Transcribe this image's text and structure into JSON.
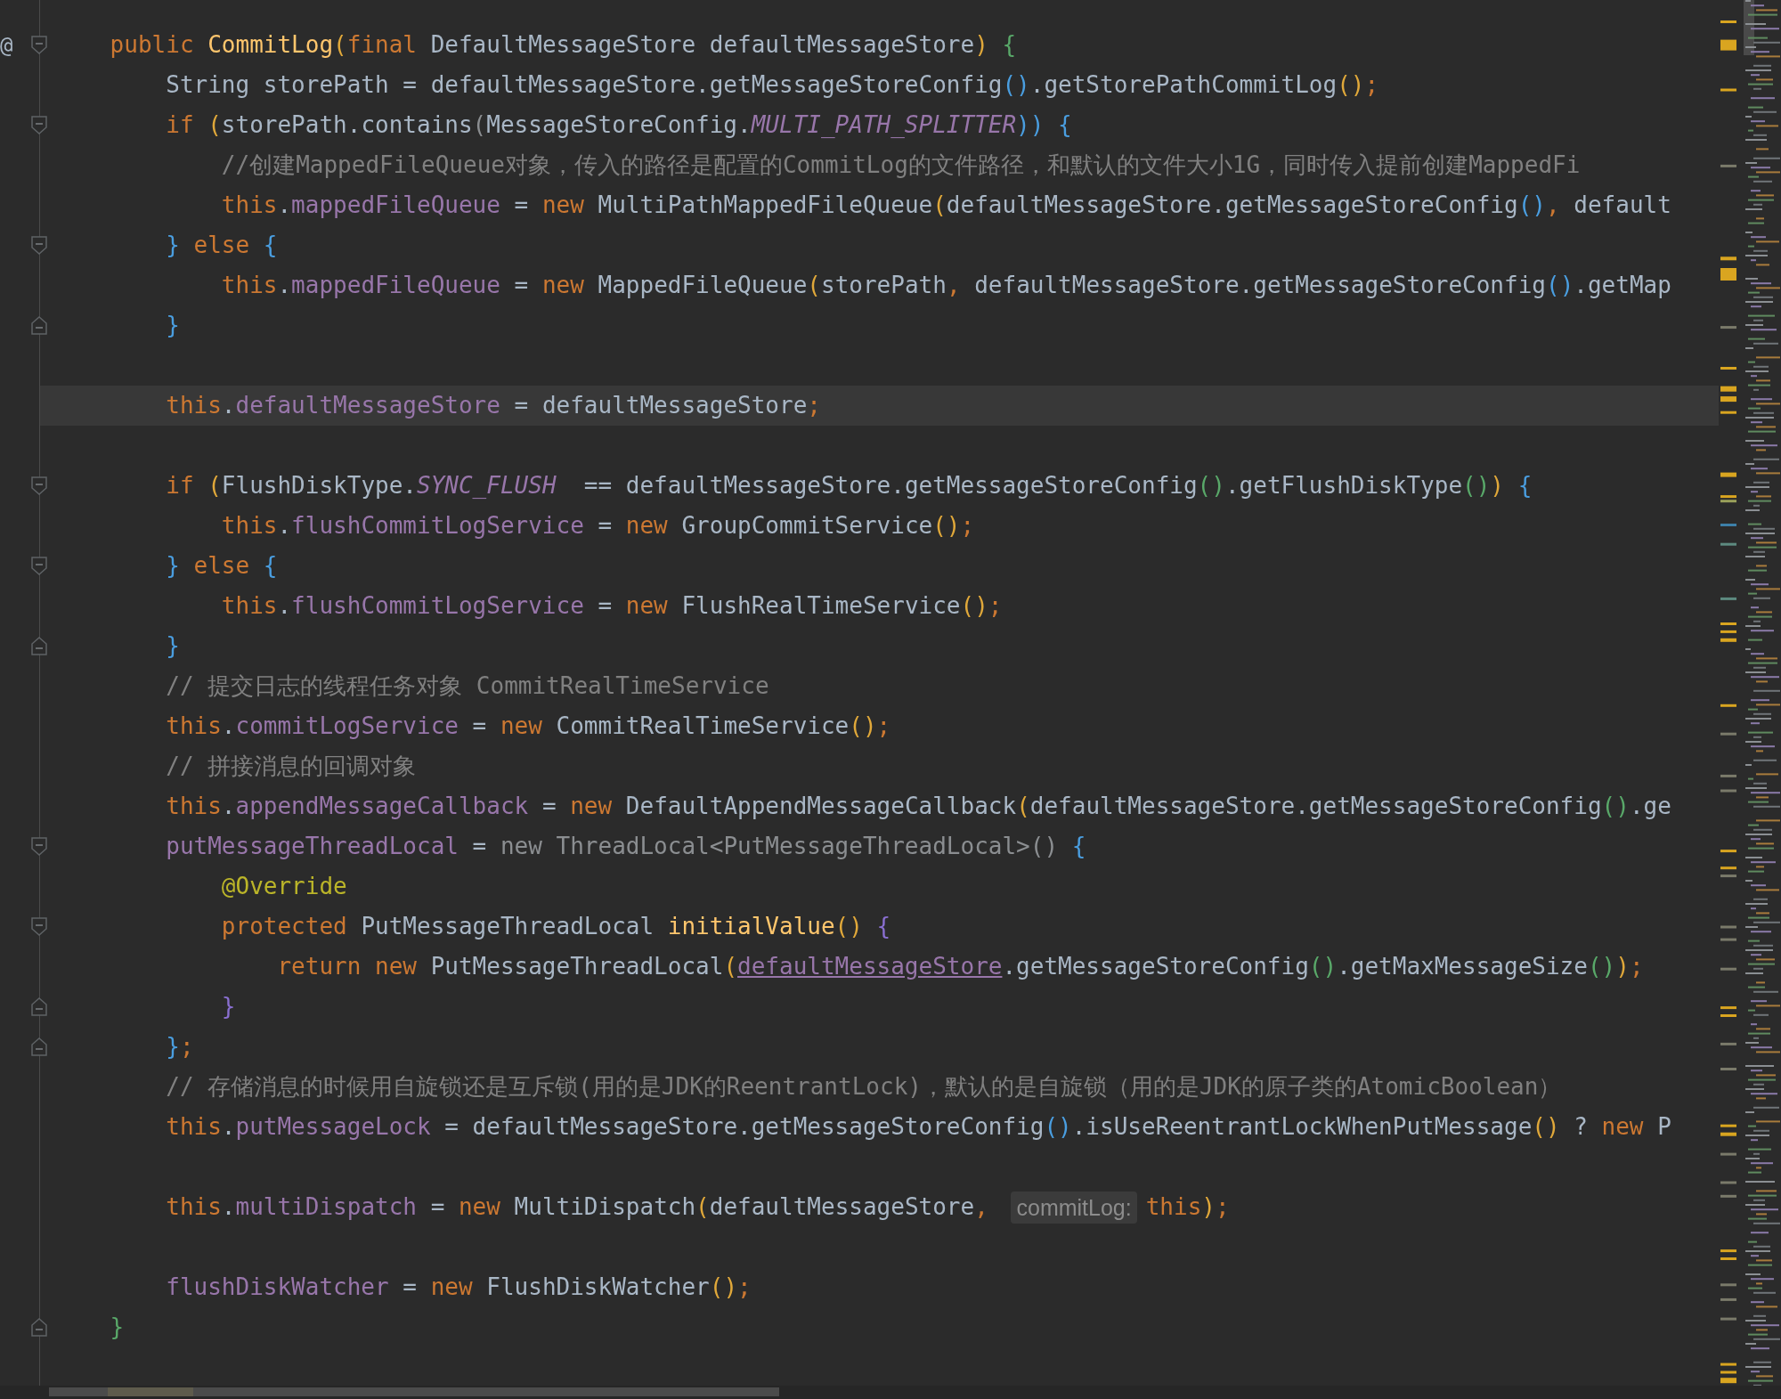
{
  "editor": {
    "lines": [
      {
        "gutter": "@",
        "kind": "open",
        "current": false,
        "tokens": [
          {
            "text": "    public ",
            "kind": "kw"
          },
          {
            "text": "CommitLog",
            "kind": "decl"
          },
          {
            "text": "(",
            "kind": "gold"
          },
          {
            "text": "final ",
            "kind": "kw"
          },
          {
            "text": "DefaultMessageStore defaultMessageStore",
            "kind": "plain"
          },
          {
            "text": ")",
            "kind": "gold"
          },
          {
            "text": " {",
            "kind": "green"
          }
        ]
      },
      {
        "kind": "code",
        "current": false,
        "tokens": [
          {
            "text": "        String storePath = defaultMessageStore.getMessageStoreConfig",
            "kind": "plain"
          },
          {
            "text": "()",
            "kind": "blue"
          },
          {
            "text": ".getStorePathCommitLog",
            "kind": "plain"
          },
          {
            "text": "()",
            "kind": "gold"
          },
          {
            "text": ";",
            "kind": "kw"
          }
        ]
      },
      {
        "kind": "open",
        "current": false,
        "tokens": [
          {
            "text": "        if ",
            "kind": "kw"
          },
          {
            "text": "(",
            "kind": "gold"
          },
          {
            "text": "storePath.contains",
            "kind": "plain"
          },
          {
            "text": "(",
            "kind": "dim"
          },
          {
            "text": "MessageStoreConfig.",
            "kind": "plain"
          },
          {
            "text": "MULTI_PATH_SPLITTER",
            "kind": "const"
          },
          {
            "text": ")) {",
            "kind": "blue"
          }
        ]
      },
      {
        "kind": "code",
        "current": false,
        "tokens": [
          {
            "text": "            //创建MappedFileQueue对象，传入的路径是配置的CommitLog的文件路径，和默认的文件大小1G，同时传入提前创建MappedFi",
            "kind": "comment"
          }
        ]
      },
      {
        "kind": "code",
        "current": false,
        "tokens": [
          {
            "text": "            this",
            "kind": "kw"
          },
          {
            "text": ".",
            "kind": "plain"
          },
          {
            "text": "mappedFileQueue",
            "kind": "field"
          },
          {
            "text": " = ",
            "kind": "plain"
          },
          {
            "text": "new ",
            "kind": "kw"
          },
          {
            "text": "MultiPathMappedFileQueue",
            "kind": "plain"
          },
          {
            "text": "(",
            "kind": "gold"
          },
          {
            "text": "defaultMessageStore.getMessageStoreConfig",
            "kind": "plain"
          },
          {
            "text": "()",
            "kind": "blue"
          },
          {
            "text": ", ",
            "kind": "kw"
          },
          {
            "text": "default",
            "kind": "plain"
          }
        ]
      },
      {
        "kind": "open",
        "current": false,
        "tokens": [
          {
            "text": "        }",
            "kind": "blue"
          },
          {
            "text": " else ",
            "kind": "kw"
          },
          {
            "text": "{",
            "kind": "blue"
          }
        ]
      },
      {
        "kind": "code",
        "current": false,
        "tokens": [
          {
            "text": "            this",
            "kind": "kw"
          },
          {
            "text": ".",
            "kind": "plain"
          },
          {
            "text": "mappedFileQueue",
            "kind": "field"
          },
          {
            "text": " = ",
            "kind": "plain"
          },
          {
            "text": "new ",
            "kind": "kw"
          },
          {
            "text": "MappedFileQueue",
            "kind": "plain"
          },
          {
            "text": "(",
            "kind": "gold"
          },
          {
            "text": "storePath",
            "kind": "plain"
          },
          {
            "text": ", ",
            "kind": "kw"
          },
          {
            "text": "defaultMessageStore.getMessageStoreConfig",
            "kind": "plain"
          },
          {
            "text": "()",
            "kind": "blue"
          },
          {
            "text": ".getMap",
            "kind": "plain"
          }
        ]
      },
      {
        "kind": "close",
        "current": false,
        "tokens": [
          {
            "text": "        }",
            "kind": "blue"
          }
        ]
      },
      {
        "kind": "code",
        "current": false
      },
      {
        "kind": "code",
        "current": true,
        "tokens": [
          {
            "text": "        this",
            "kind": "kw"
          },
          {
            "text": ".",
            "kind": "plain"
          },
          {
            "text": "defaultMessageStore",
            "kind": "field"
          },
          {
            "text": " = defaultMessageStore",
            "kind": "plain"
          },
          {
            "text": ";",
            "kind": "kw"
          }
        ]
      },
      {
        "kind": "code",
        "current": false
      },
      {
        "kind": "open",
        "current": false,
        "tokens": [
          {
            "text": "        if ",
            "kind": "kw"
          },
          {
            "text": "(",
            "kind": "gold"
          },
          {
            "text": "FlushDiskType.",
            "kind": "plain"
          },
          {
            "text": "SYNC_FLUSH",
            "kind": "const"
          },
          {
            "text": "  == defaultMessageStore.getMessageStoreConfig",
            "kind": "plain"
          },
          {
            "text": "()",
            "kind": "green"
          },
          {
            "text": ".getFlushDiskType",
            "kind": "plain"
          },
          {
            "text": "()",
            "kind": "green"
          },
          {
            "text": ")",
            "kind": "gold"
          },
          {
            "text": " {",
            "kind": "blue"
          }
        ]
      },
      {
        "kind": "code",
        "current": false,
        "tokens": [
          {
            "text": "            this",
            "kind": "kw"
          },
          {
            "text": ".",
            "kind": "plain"
          },
          {
            "text": "flushCommitLogService",
            "kind": "field"
          },
          {
            "text": " = ",
            "kind": "plain"
          },
          {
            "text": "new ",
            "kind": "kw"
          },
          {
            "text": "GroupCommitService",
            "kind": "plain"
          },
          {
            "text": "()",
            "kind": "gold"
          },
          {
            "text": ";",
            "kind": "kw"
          }
        ]
      },
      {
        "kind": "open",
        "current": false,
        "tokens": [
          {
            "text": "        }",
            "kind": "blue"
          },
          {
            "text": " else ",
            "kind": "kw"
          },
          {
            "text": "{",
            "kind": "blue"
          }
        ]
      },
      {
        "kind": "code",
        "current": false,
        "tokens": [
          {
            "text": "            this",
            "kind": "kw"
          },
          {
            "text": ".",
            "kind": "plain"
          },
          {
            "text": "flushCommitLogService",
            "kind": "field"
          },
          {
            "text": " = ",
            "kind": "plain"
          },
          {
            "text": "new ",
            "kind": "kw"
          },
          {
            "text": "FlushRealTimeService",
            "kind": "plain"
          },
          {
            "text": "()",
            "kind": "gold"
          },
          {
            "text": ";",
            "kind": "kw"
          }
        ]
      },
      {
        "kind": "close",
        "current": false,
        "tokens": [
          {
            "text": "        }",
            "kind": "blue"
          }
        ]
      },
      {
        "kind": "code",
        "current": false,
        "tokens": [
          {
            "text": "        // 提交日志的线程任务对象 CommitRealTimeService",
            "kind": "comment"
          }
        ]
      },
      {
        "kind": "code",
        "current": false,
        "tokens": [
          {
            "text": "        this",
            "kind": "kw"
          },
          {
            "text": ".",
            "kind": "plain"
          },
          {
            "text": "commitLogService",
            "kind": "field"
          },
          {
            "text": " = ",
            "kind": "plain"
          },
          {
            "text": "new ",
            "kind": "kw"
          },
          {
            "text": "CommitRealTimeService",
            "kind": "plain"
          },
          {
            "text": "()",
            "kind": "gold"
          },
          {
            "text": ";",
            "kind": "kw"
          }
        ]
      },
      {
        "kind": "code",
        "current": false,
        "tokens": [
          {
            "text": "        // 拼接消息的回调对象",
            "kind": "comment"
          }
        ]
      },
      {
        "kind": "code",
        "current": false,
        "tokens": [
          {
            "text": "        this",
            "kind": "kw"
          },
          {
            "text": ".",
            "kind": "plain"
          },
          {
            "text": "appendMessageCallback",
            "kind": "field"
          },
          {
            "text": " = ",
            "kind": "plain"
          },
          {
            "text": "new ",
            "kind": "kw"
          },
          {
            "text": "DefaultAppendMessageCallback",
            "kind": "plain"
          },
          {
            "text": "(",
            "kind": "gold"
          },
          {
            "text": "defaultMessageStore.getMessageStoreConfig",
            "kind": "plain"
          },
          {
            "text": "()",
            "kind": "green"
          },
          {
            "text": ".ge",
            "kind": "plain"
          }
        ]
      },
      {
        "kind": "open",
        "current": false,
        "tokens": [
          {
            "text": "        putMessageThreadLocal",
            "kind": "field"
          },
          {
            "text": " = ",
            "kind": "plain"
          },
          {
            "text": "new ThreadLocal<PutMessageThreadLocal>()",
            "kind": "dim"
          },
          {
            "text": " {",
            "kind": "blue"
          }
        ]
      },
      {
        "kind": "code",
        "current": false,
        "tokens": [
          {
            "text": "            @Override",
            "kind": "ann"
          }
        ]
      },
      {
        "kind": "open",
        "current": false,
        "tokens": [
          {
            "text": "            protected ",
            "kind": "kw"
          },
          {
            "text": "PutMessageThreadLocal ",
            "kind": "plain"
          },
          {
            "text": "initialValue",
            "kind": "decl"
          },
          {
            "text": "()",
            "kind": "gold"
          },
          {
            "text": " {",
            "kind": "purple"
          }
        ]
      },
      {
        "kind": "code",
        "current": false,
        "tokens": [
          {
            "text": "                return new ",
            "kind": "kw"
          },
          {
            "text": "PutMessageThreadLocal",
            "kind": "plain"
          },
          {
            "text": "(",
            "kind": "gold"
          },
          {
            "text": "defaultMessageStore",
            "kind": "link"
          },
          {
            "text": ".getMessageStoreConfig",
            "kind": "plain"
          },
          {
            "text": "()",
            "kind": "green"
          },
          {
            "text": ".getMaxMessageSize",
            "kind": "plain"
          },
          {
            "text": "()",
            "kind": "green"
          },
          {
            "text": ")",
            "kind": "gold"
          },
          {
            "text": ";",
            "kind": "kw"
          }
        ]
      },
      {
        "kind": "close",
        "current": false,
        "tokens": [
          {
            "text": "            }",
            "kind": "purple"
          }
        ]
      },
      {
        "kind": "close",
        "current": false,
        "tokens": [
          {
            "text": "        }",
            "kind": "blue"
          },
          {
            "text": ";",
            "kind": "kw"
          }
        ]
      },
      {
        "kind": "code",
        "current": false,
        "tokens": [
          {
            "text": "        // 存储消息的时候用自旋锁还是互斥锁(用的是JDK的ReentrantLock)，默认的是自旋锁（用的是JDK的原子类的AtomicBoolean）",
            "kind": "comment"
          }
        ]
      },
      {
        "kind": "code",
        "current": false,
        "tokens": [
          {
            "text": "        this",
            "kind": "kw"
          },
          {
            "text": ".",
            "kind": "plain"
          },
          {
            "text": "putMessageLock",
            "kind": "field"
          },
          {
            "text": " = defaultMessageStore.getMessageStoreConfig",
            "kind": "plain"
          },
          {
            "text": "()",
            "kind": "blue"
          },
          {
            "text": ".isUseReentrantLockWhenPutMessage",
            "kind": "plain"
          },
          {
            "text": "()",
            "kind": "gold"
          },
          {
            "text": " ? ",
            "kind": "plain"
          },
          {
            "text": "new ",
            "kind": "kw"
          },
          {
            "text": "P",
            "kind": "plain"
          }
        ]
      },
      {
        "kind": "code",
        "current": false
      },
      {
        "kind": "code",
        "current": false,
        "tokens": [
          {
            "text": "        this",
            "kind": "kw"
          },
          {
            "text": ".",
            "kind": "plain"
          },
          {
            "text": "multiDispatch",
            "kind": "field"
          },
          {
            "text": " = ",
            "kind": "plain"
          },
          {
            "text": "new ",
            "kind": "kw"
          },
          {
            "text": "MultiDispatch",
            "kind": "plain"
          },
          {
            "text": "(",
            "kind": "gold"
          },
          {
            "text": "defaultMessageStore",
            "kind": "plain"
          },
          {
            "text": ", ",
            "kind": "kw"
          },
          {
            "text": "commitLog:",
            "kind": "hint"
          },
          {
            "text": "this",
            "kind": "kw"
          },
          {
            "text": ")",
            "kind": "gold"
          },
          {
            "text": ";",
            "kind": "kw"
          }
        ]
      },
      {
        "kind": "code",
        "current": false
      },
      {
        "kind": "code",
        "current": false,
        "tokens": [
          {
            "text": "        flushDiskWatcher",
            "kind": "field"
          },
          {
            "text": " = ",
            "kind": "plain"
          },
          {
            "text": "new ",
            "kind": "kw"
          },
          {
            "text": "FlushDiskWatcher",
            "kind": "plain"
          },
          {
            "text": "()",
            "kind": "gold"
          },
          {
            "text": ";",
            "kind": "kw"
          }
        ]
      },
      {
        "kind": "close",
        "current": false,
        "tokens": [
          {
            "text": "    }",
            "kind": "green"
          }
        ]
      }
    ]
  }
}
